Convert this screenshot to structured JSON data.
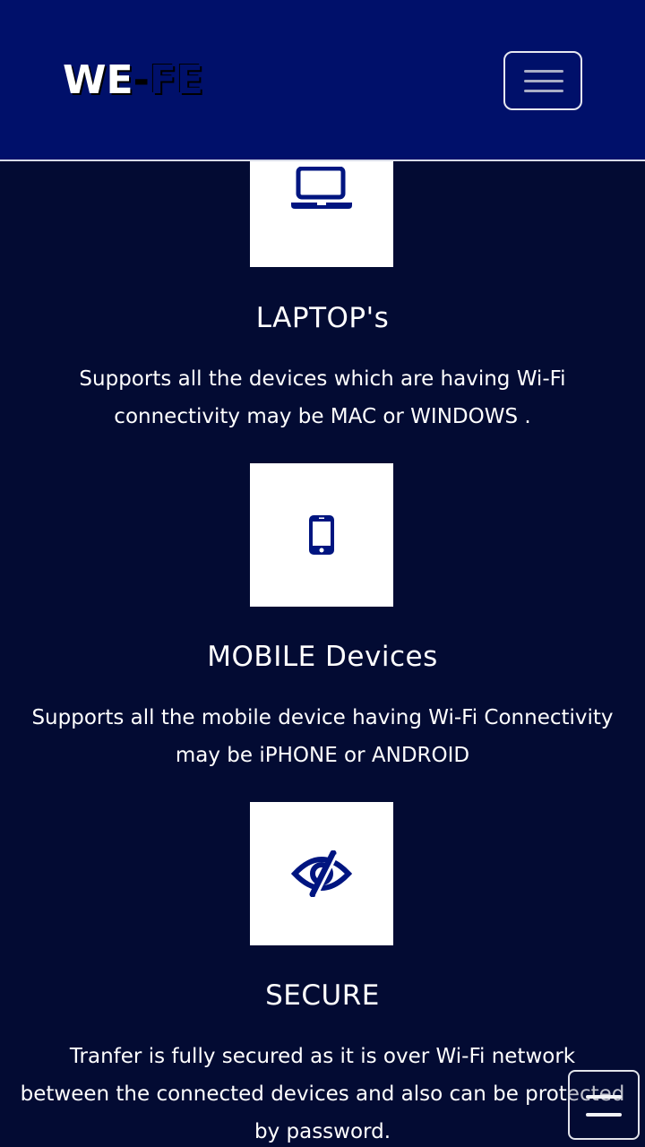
{
  "nav": {
    "brand_we": "WE",
    "brand_dash": "-",
    "brand_fe": "FE"
  },
  "features": [
    {
      "icon": "laptop-icon",
      "title": "LAPTOP's",
      "text_line1": "Supports all the devices which are having Wi-Fi",
      "text_line2": "connectivity may be MAC or WINDOWS ."
    },
    {
      "icon": "mobile-phone-icon",
      "title": "MOBILE Devices",
      "text_line1": "Supports all the mobile device having Wi-Fi Connectivity",
      "text_line2": "may be iPHONE or ANDROID"
    },
    {
      "icon": "eye-slash-icon",
      "title": "SECURE",
      "text_line1": "Tranfer is fully secured as it is over Wi-Fi network",
      "text_line2": "between the connected devices and also can be protected",
      "text_line3": "by password."
    }
  ],
  "colors": {
    "background": "#030b33",
    "navbar": "#00106a",
    "icon": "#001580"
  }
}
